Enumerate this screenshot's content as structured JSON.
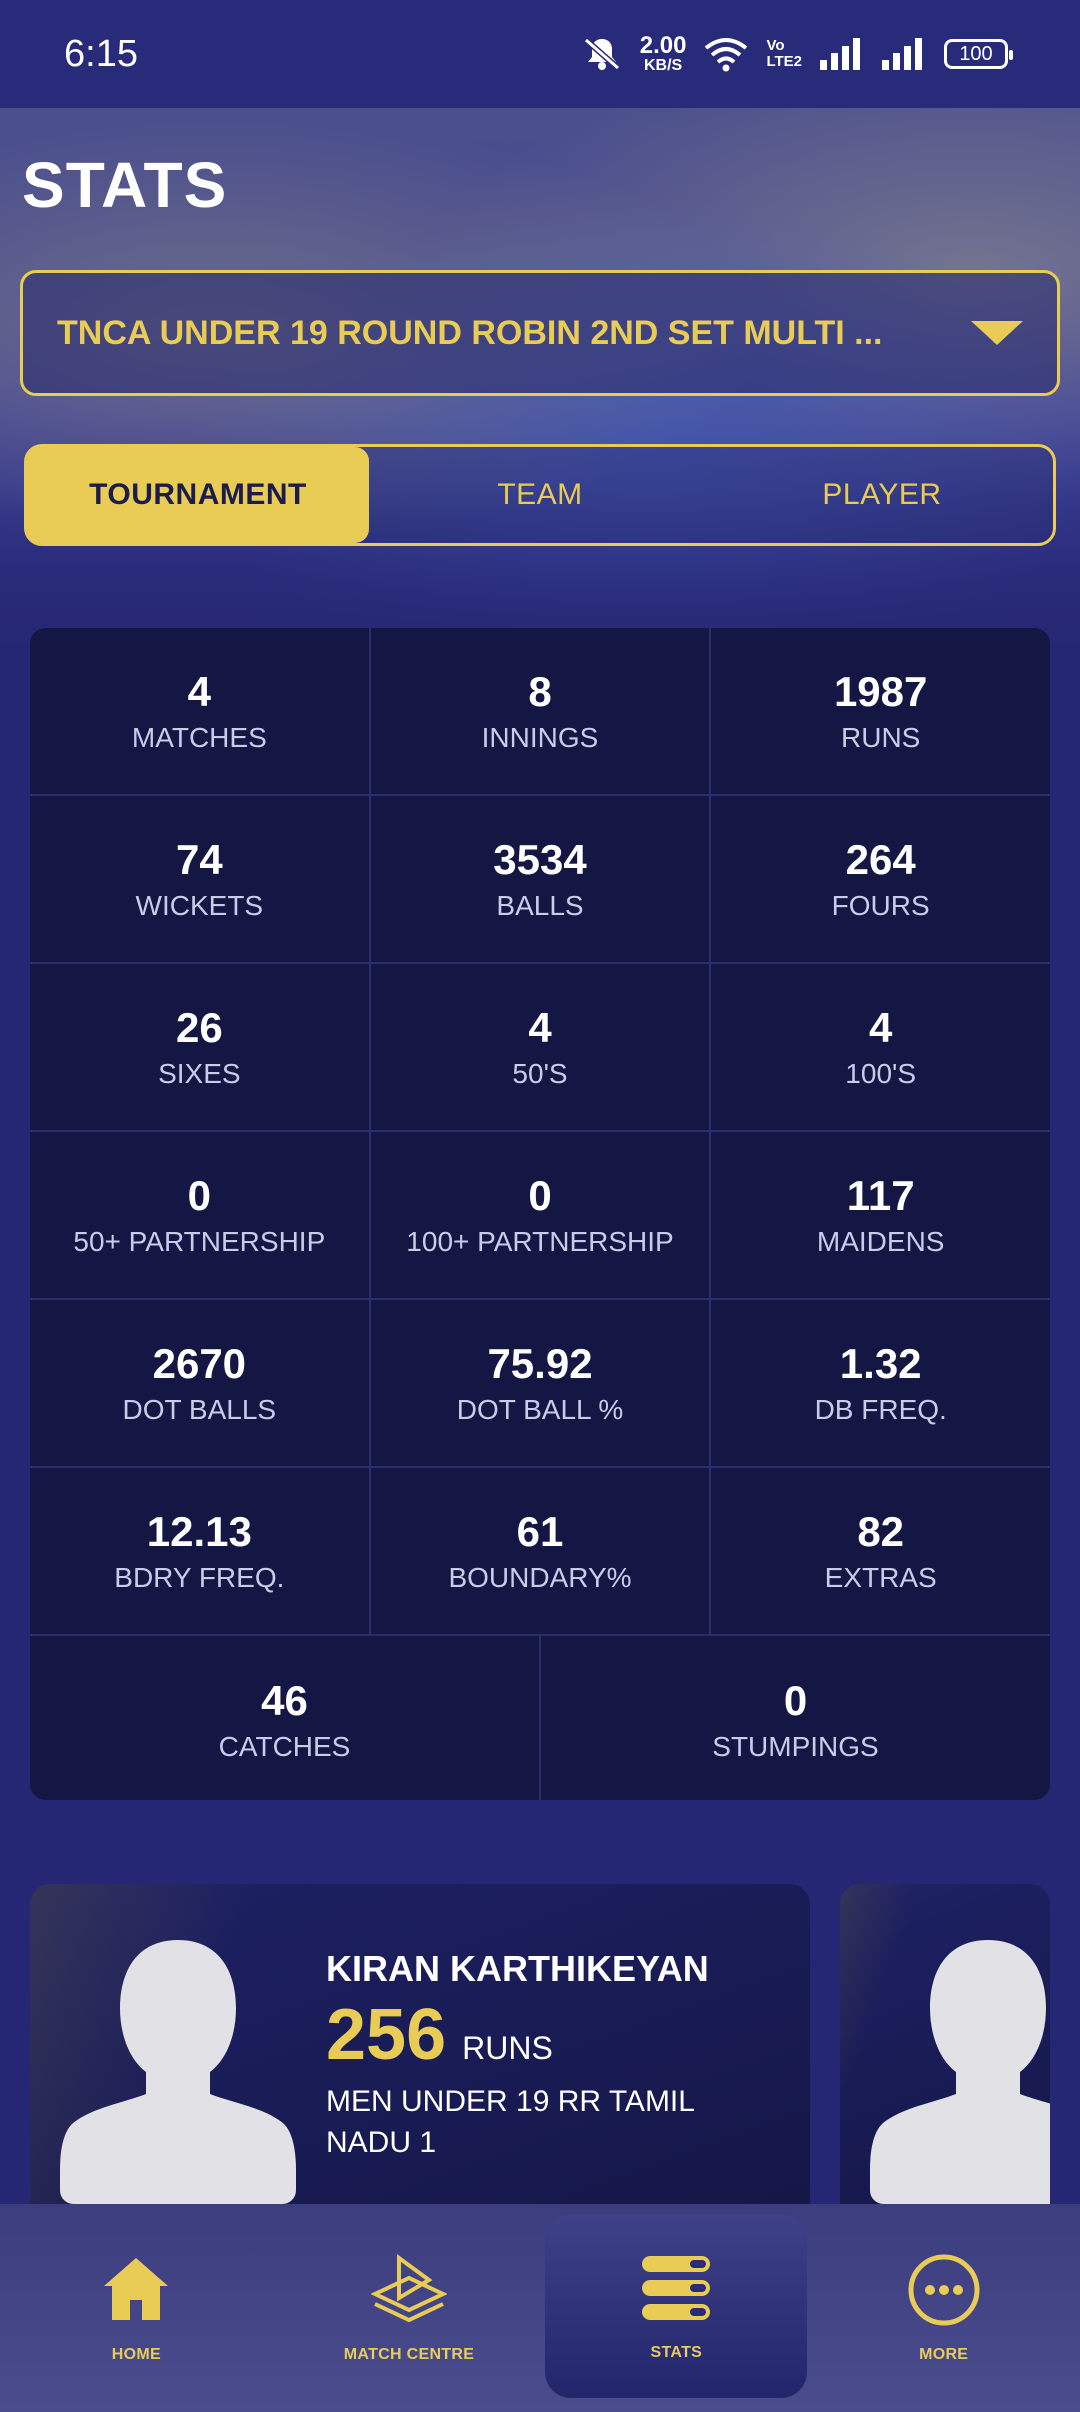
{
  "status_bar": {
    "time": "6:15",
    "speed_value": "2.00",
    "speed_unit": "KB/S",
    "volte_top": "Vo",
    "volte_bottom": "LTE2",
    "battery": "100"
  },
  "page": {
    "title": "STATS"
  },
  "tournament_select": {
    "value": "TNCA UNDER 19 ROUND ROBIN 2ND SET MULTI ..."
  },
  "tabs": [
    {
      "label": "TOURNAMENT",
      "active": true
    },
    {
      "label": "TEAM",
      "active": false
    },
    {
      "label": "PLAYER",
      "active": false
    }
  ],
  "stats": [
    [
      {
        "value": "4",
        "label": "MATCHES"
      },
      {
        "value": "8",
        "label": "INNINGS"
      },
      {
        "value": "1987",
        "label": "RUNS"
      }
    ],
    [
      {
        "value": "74",
        "label": "WICKETS"
      },
      {
        "value": "3534",
        "label": "BALLS"
      },
      {
        "value": "264",
        "label": "FOURS"
      }
    ],
    [
      {
        "value": "26",
        "label": "SIXES"
      },
      {
        "value": "4",
        "label": "50'S"
      },
      {
        "value": "4",
        "label": "100'S"
      }
    ],
    [
      {
        "value": "0",
        "label": "50+ PARTNERSHIP"
      },
      {
        "value": "0",
        "label": "100+ PARTNERSHIP"
      },
      {
        "value": "117",
        "label": "MAIDENS"
      }
    ],
    [
      {
        "value": "2670",
        "label": "DOT BALLS"
      },
      {
        "value": "75.92",
        "label": "DOT BALL %"
      },
      {
        "value": "1.32",
        "label": "DB FREQ."
      }
    ],
    [
      {
        "value": "12.13",
        "label": "BDRY FREQ."
      },
      {
        "value": "61",
        "label": "BOUNDARY%"
      },
      {
        "value": "82",
        "label": "EXTRAS"
      }
    ],
    [
      {
        "value": "46",
        "label": "CATCHES"
      },
      {
        "value": "0",
        "label": "STUMPINGS"
      }
    ]
  ],
  "player_card": {
    "name": "KIRAN KARTHIKEYAN",
    "runs": "256",
    "runs_label": "RUNS",
    "team": "MEN UNDER 19 RR TAMIL NADU 1"
  },
  "bottom_nav": [
    {
      "label": "HOME",
      "icon": "home-icon"
    },
    {
      "label": "MATCH CENTRE",
      "icon": "play-stack-icon"
    },
    {
      "label": "STATS",
      "icon": "stats-bars-icon",
      "active": true
    },
    {
      "label": "MORE",
      "icon": "more-dots-icon"
    }
  ],
  "colors": {
    "accent": "#e9cc55",
    "background": "#262774",
    "cell": "#141644"
  }
}
